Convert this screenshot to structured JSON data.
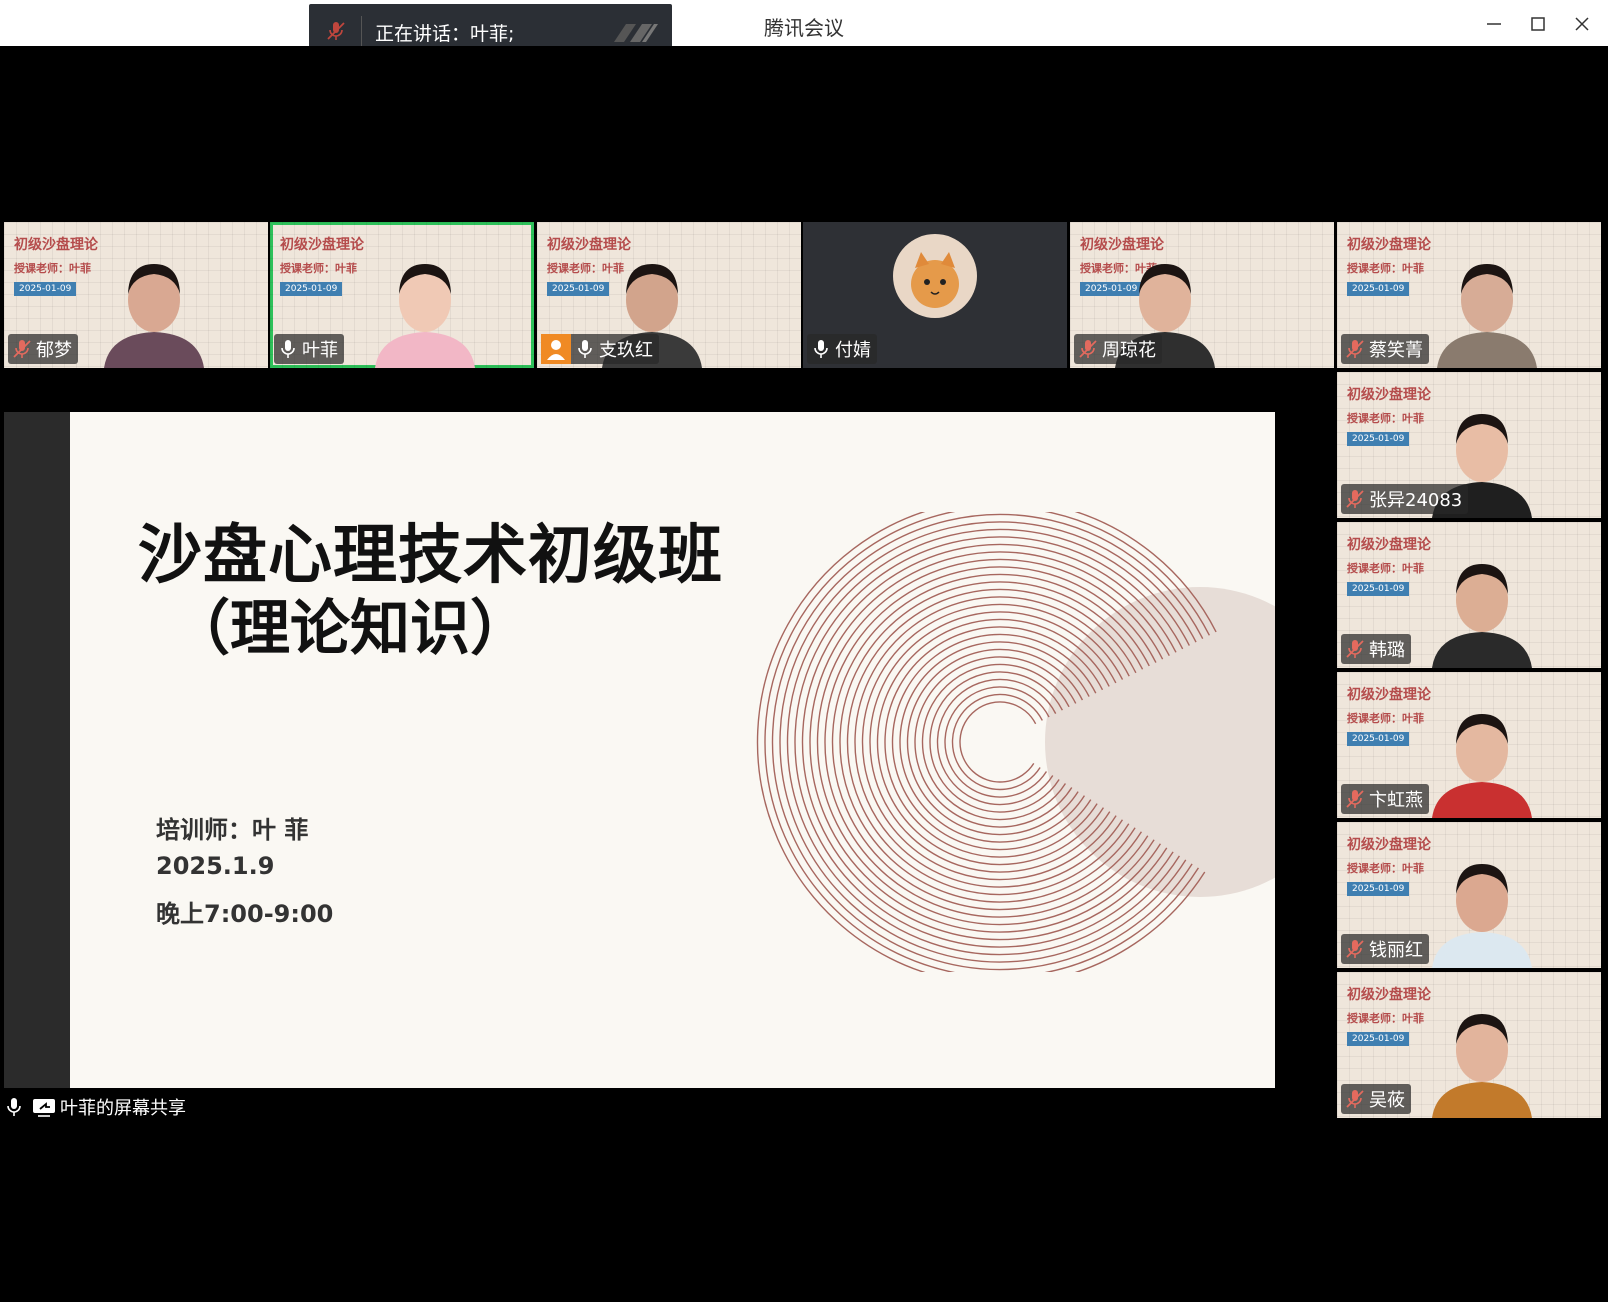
{
  "window": {
    "title": "腾讯会议"
  },
  "speaking": {
    "text": "正在讲话：叶菲;"
  },
  "tile_bg": {
    "title": "初级沙盘理论",
    "teacher": "授课老师：叶菲",
    "date": "2025-01-09"
  },
  "participants": {
    "top": [
      {
        "name": "郁梦",
        "muted": true
      },
      {
        "name": "叶菲",
        "muted": false
      },
      {
        "name": "支玖红",
        "muted": false
      },
      {
        "name": "付婧",
        "muted": false
      },
      {
        "name": "周琼花",
        "muted": true
      },
      {
        "name": "蔡笑菁",
        "muted": true
      }
    ],
    "side": [
      {
        "name": "张异24083",
        "muted": true
      },
      {
        "name": "韩璐",
        "muted": true
      },
      {
        "name": "卞虹燕",
        "muted": true
      },
      {
        "name": "钱丽红",
        "muted": true
      },
      {
        "name": "吴莜",
        "muted": true
      }
    ]
  },
  "slide": {
    "title_line1": "沙盘心理技术初级班",
    "title_line2": "（理论知识）",
    "trainer": "培训师：叶 菲",
    "date": "2025.1.9",
    "time": "晚上7:00-9:00"
  },
  "share": {
    "label": "叶菲的屏幕共享"
  }
}
